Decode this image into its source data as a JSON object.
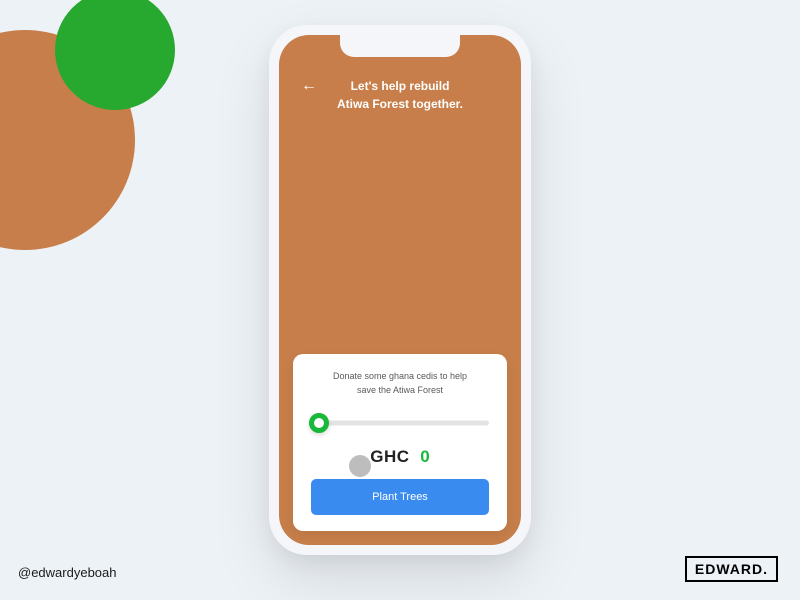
{
  "decor": {
    "brown": "#c77e4a",
    "green": "#27a82e"
  },
  "phone": {
    "headline_line1": "Let's help rebuild",
    "headline_line2": "Atiwa Forest together.",
    "back_icon": "←"
  },
  "card": {
    "prompt_line1": "Donate some ghana cedis to help",
    "prompt_line2": "save the Atiwa Forest",
    "currency": "GHC",
    "amount": "0",
    "cta": "Plant Trees",
    "slider_value": 0,
    "accent": "#18b83a",
    "button_color": "#3a8bf0"
  },
  "footer": {
    "handle": "@edwardyeboah",
    "logo": "EDWARD."
  }
}
